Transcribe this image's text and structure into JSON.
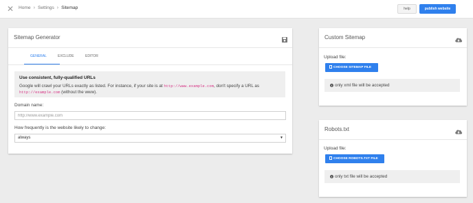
{
  "breadcrumb": {
    "items": [
      "Home",
      "Settings",
      "Sitemap"
    ]
  },
  "header": {
    "help_label": "help",
    "publish_label": "publish website"
  },
  "generator": {
    "title": "Sitemap Generator",
    "icon": "save-icon",
    "tabs": [
      "GENERAL",
      "EXCLUDE",
      "EDITOR"
    ],
    "active_tab": "GENERAL",
    "notice": {
      "title": "Use consistent, fully-qualified URLs",
      "body_pre": "Google will crawl your URLs exactly as listed. For instance, if your site is at ",
      "example_1": "http://www.example.com",
      "body_mid": ", don't specify a URL as ",
      "example_2": "http://example.com",
      "body_post": " (without the www)."
    },
    "domain": {
      "label": "Domain name:",
      "placeholder": "http://www.example.com",
      "value": ""
    },
    "frequency": {
      "label": "How frequently is the website likely to change:",
      "selected": "always"
    }
  },
  "custom_sitemap": {
    "title": "Custom Sitemap",
    "icon": "cloud-upload-icon",
    "upload_label": "Upload file:",
    "button_label": "CHOOSE SITEMAP FILE",
    "info": "only xml file will be accepted"
  },
  "robots": {
    "title": "Robots.txt",
    "icon": "cloud-upload-icon",
    "upload_label": "Upload file:",
    "button_label": "CHOOSE ROBOTS.TXT FILE",
    "info": "only txt file will be accepted"
  },
  "colors": {
    "accent": "#2f80ed",
    "background": "#ececec",
    "code": "#d63384"
  }
}
